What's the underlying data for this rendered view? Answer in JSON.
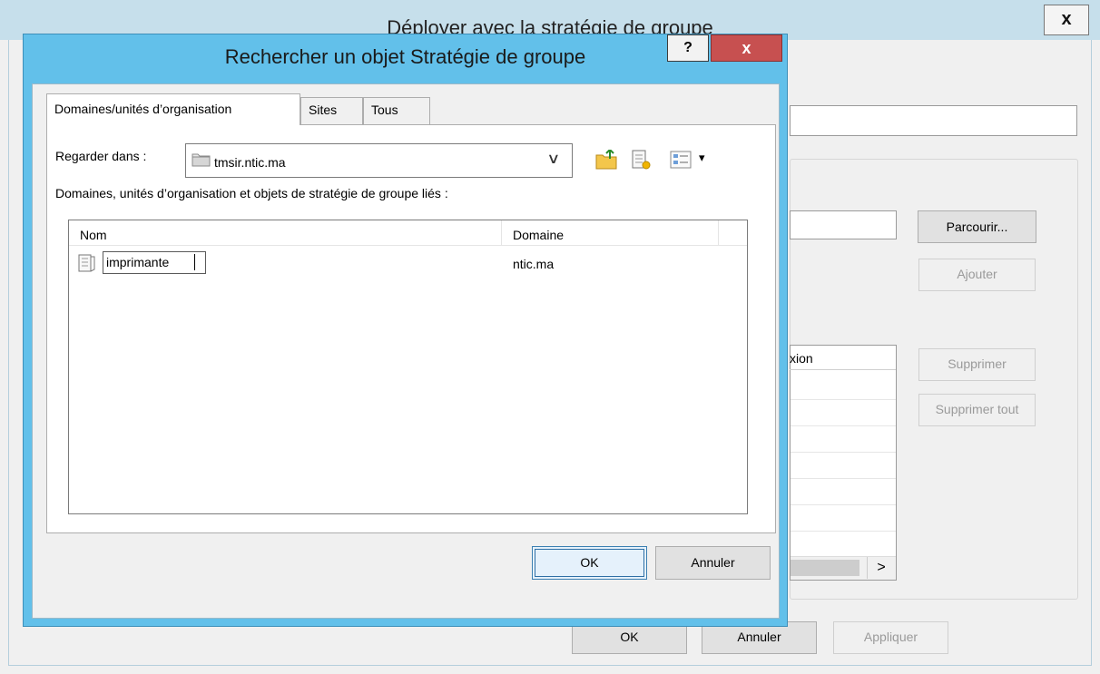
{
  "background_window": {
    "title": "Déployer avec la stratégie de groupe",
    "close_glyph": "x",
    "buttons": {
      "browse": "Parcourir...",
      "add": "Ajouter",
      "remove": "Supprimer",
      "remove_all": "Supprimer tout",
      "ok": "OK",
      "cancel": "Annuler",
      "apply": "Appliquer"
    },
    "list": {
      "column_header_partial": "xion",
      "scroll_right_glyph": ">"
    }
  },
  "dialog": {
    "title": "Rechercher un objet Stratégie de groupe",
    "help_glyph": "?",
    "close_glyph": "x",
    "tabs": [
      {
        "label": "Domaines/unités d’organisation",
        "active": true
      },
      {
        "label": "Sites",
        "active": false
      },
      {
        "label": "Tous",
        "active": false
      }
    ],
    "look_in": {
      "label": "Regarder dans :",
      "value": "tmsir.ntic.ma",
      "chevron": "∨"
    },
    "toolbar_icons": [
      "folder-up-icon",
      "new-gpo-icon",
      "view-menu-icon"
    ],
    "view_dropdown_glyph": "▾",
    "list_description": "Domaines, unités d’organisation et objets de stratégie de groupe liés :",
    "columns": [
      "Nom",
      "Domaine"
    ],
    "rows": [
      {
        "name": "imprimante",
        "domain": "ntic.ma",
        "editing": true
      }
    ],
    "buttons": {
      "ok": "OK",
      "cancel": "Annuler"
    }
  },
  "colors": {
    "dialog_frame": "#62c0ea",
    "close_button": "#c75050",
    "background_titlebar": "#c6dfeb",
    "window_face": "#f0f0f0"
  }
}
